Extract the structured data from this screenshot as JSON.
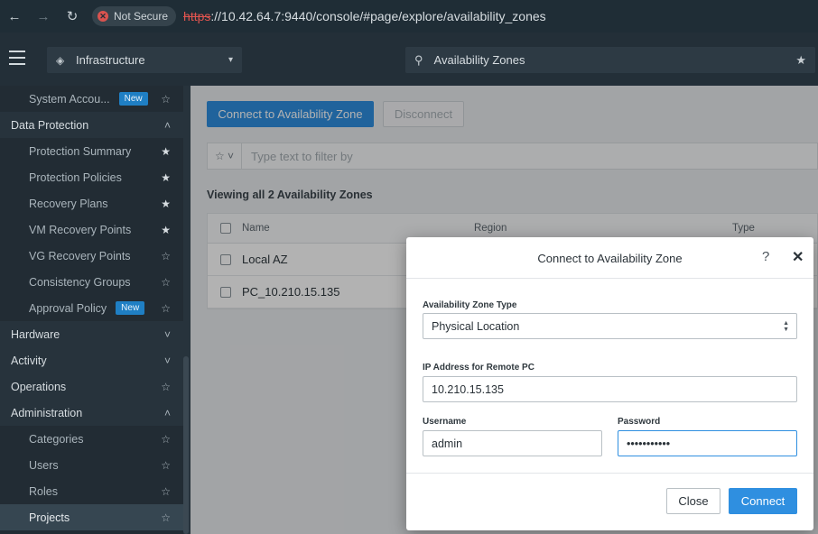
{
  "browser": {
    "back_icon": "arrow-left",
    "forward_icon": "arrow-right",
    "reload_icon": "reload",
    "security_label": "Not Secure",
    "url_scheme": "https",
    "url_rest": "://10.42.64.7:9440/console/#page/explore/availability_zones"
  },
  "header": {
    "context_label": "Infrastructure",
    "search_value": "Availability Zones"
  },
  "sidebar": {
    "items": [
      {
        "label": "System Accou...",
        "badge": "New",
        "icon": "star-outline",
        "type": "child"
      },
      {
        "label": "Data Protection",
        "icon": "chevron-up",
        "type": "section"
      },
      {
        "label": "Protection Summary",
        "icon": "star-filled",
        "type": "child"
      },
      {
        "label": "Protection Policies",
        "icon": "star-filled",
        "type": "child"
      },
      {
        "label": "Recovery Plans",
        "icon": "star-filled",
        "type": "child"
      },
      {
        "label": "VM Recovery Points",
        "icon": "star-filled",
        "type": "child"
      },
      {
        "label": "VG Recovery Points",
        "icon": "star-outline",
        "type": "child"
      },
      {
        "label": "Consistency Groups",
        "icon": "star-outline",
        "type": "child"
      },
      {
        "label": "Approval Policy",
        "badge": "New",
        "icon": "star-outline",
        "type": "child"
      },
      {
        "label": "Hardware",
        "icon": "chevron-down",
        "type": "section"
      },
      {
        "label": "Activity",
        "icon": "chevron-down",
        "type": "section"
      },
      {
        "label": "Operations",
        "icon": "star-outline",
        "type": "section"
      },
      {
        "label": "Administration",
        "icon": "chevron-up",
        "type": "section"
      },
      {
        "label": "Categories",
        "icon": "star-outline",
        "type": "child"
      },
      {
        "label": "Users",
        "icon": "star-outline",
        "type": "child"
      },
      {
        "label": "Roles",
        "icon": "star-outline",
        "type": "child"
      },
      {
        "label": "Projects",
        "icon": "star-outline",
        "type": "child"
      }
    ]
  },
  "main": {
    "connect_button": "Connect to Availability Zone",
    "disconnect_button": "Disconnect",
    "filter_placeholder": "Type text to filter by",
    "viewing_text": "Viewing all 2 Availability Zones",
    "table": {
      "columns": [
        "Name",
        "Region",
        "Type"
      ],
      "rows": [
        {
          "name": "Local AZ"
        },
        {
          "name": "PC_10.210.15.135"
        }
      ]
    }
  },
  "modal": {
    "title": "Connect to Availability Zone",
    "help_icon": "question-mark",
    "close_icon": "x",
    "az_type_label": "Availability Zone Type",
    "az_type_value": "Physical Location",
    "ip_label": "IP Address for Remote PC",
    "ip_value": "10.210.15.135",
    "username_label": "Username",
    "username_value": "admin",
    "password_label": "Password",
    "password_value": "•••••••••••",
    "close_button": "Close",
    "connect_button": "Connect"
  },
  "colors": {
    "primary": "#2f8fe0",
    "sidebar_bg": "#27333c",
    "header_bg": "#232f38",
    "not_secure": "#d9534f"
  }
}
